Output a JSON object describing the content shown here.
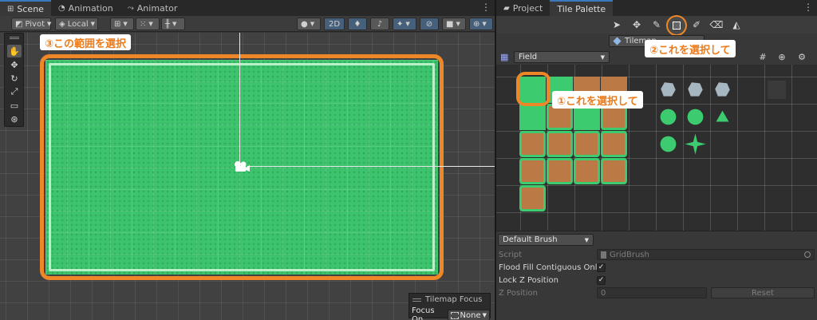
{
  "scene": {
    "tabs": [
      {
        "label": "Scene",
        "icon": "grid-icon"
      },
      {
        "label": "Animation",
        "icon": "clock-icon"
      },
      {
        "label": "Animator",
        "icon": "animator-icon"
      }
    ],
    "toolbar": {
      "pivot_label": "Pivot",
      "local_label": "Local",
      "mode_2d_label": "2D"
    },
    "callout_3": "③この範囲を選択",
    "focus_overlay": {
      "title": "Tilemap Focus",
      "focus_on_label": "Focus On",
      "focus_value": "None"
    }
  },
  "palette": {
    "tabs": [
      {
        "label": "Project",
        "icon": "folder-icon"
      },
      {
        "label": "Tile Palette"
      }
    ],
    "active_tilemap": "Tilemap",
    "palette_name": "Field",
    "callout_2": "②これを選択して",
    "callout_1": "①これを選択して",
    "brush": {
      "name": "Default Brush",
      "script_label": "Script",
      "script_value": "GridBrush",
      "flood_fill_label": "Flood Fill Contiguous Only",
      "flood_fill_checked": "✓",
      "lock_z_label": "Lock Z Position",
      "lock_z_checked": "✓",
      "z_position_label": "Z Position",
      "z_position_value": "0",
      "reset_label": "Reset"
    }
  },
  "colors": {
    "accent_orange": "#ee8727",
    "tile_grass": "#3ccb6e",
    "tile_dirt": "#bb7a45",
    "active_tab_blue": "#3a79bb"
  }
}
